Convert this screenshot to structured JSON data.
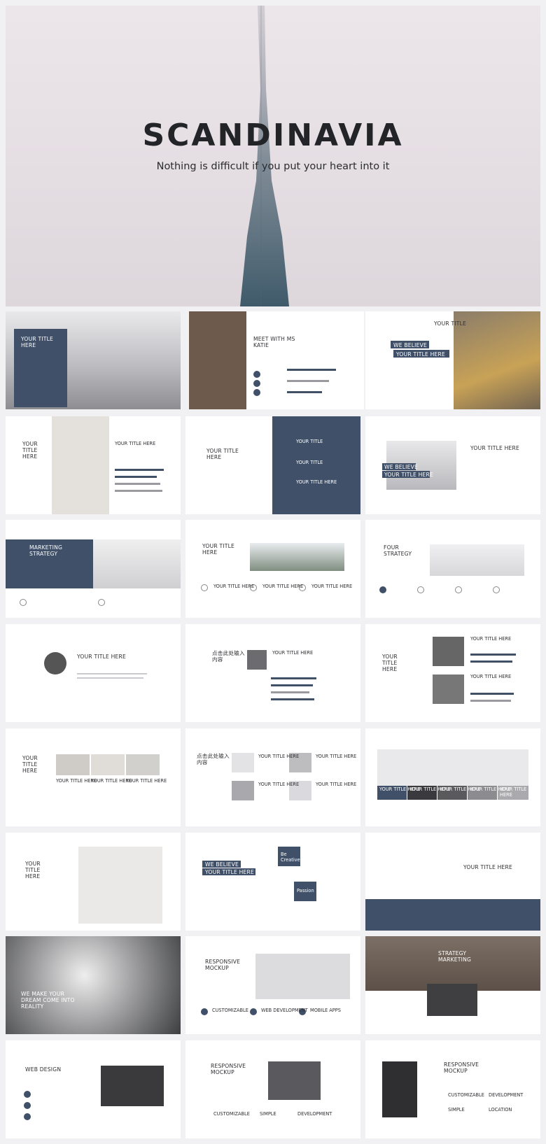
{
  "hero": {
    "title": "SCANDINAVIA",
    "subtitle": "Nothing is difficult if you put your heart into it"
  },
  "slides": {
    "s1": {
      "title": "YOUR TITLE HERE"
    },
    "s2": {
      "title": "MEET WITH MS KATIE"
    },
    "s3": {
      "title": "YOUR TITLE",
      "believe": "WE BELIEVE",
      "title2": "YOUR TITLE HERE"
    },
    "s4": {
      "title": "YOUR TITLE HERE",
      "title2": "YOUR TITLE HERE"
    },
    "s5": {
      "title": "YOUR TITLE HERE",
      "item1": "YOUR TITLE",
      "item2": "YOUR TITLE",
      "item3": "YOUR TITLE HERE"
    },
    "s6": {
      "title": "YOUR TITLE HERE",
      "believe": "WE BELIEVE",
      "title2": "YOUR TITLE HERE"
    },
    "s7": {
      "title": "MARKETING STRATEGY"
    },
    "s8": {
      "title": "YOUR TITLE HERE",
      "c1": "YOUR TITLE HERE",
      "c2": "YOUR TITLE HERE",
      "c3": "YOUR TITLE HERE"
    },
    "s9": {
      "title": "FOUR STRATEGY"
    },
    "s10": {
      "title": "YOUR TITLE HERE"
    },
    "s11": {
      "title": "点击此处输入内容",
      "title2": "YOUR TITLE HERE"
    },
    "s12": {
      "title": "YOUR TITLE HERE",
      "t1": "YOUR TITLE HERE",
      "t2": "YOUR TITLE HERE"
    },
    "s13": {
      "title": "YOUR TITLE HERE",
      "t1": "YOUR TITLE HERE",
      "t2": "YOUR TITLE HERE",
      "t3": "YOUR TITLE HERE"
    },
    "s14": {
      "title": "点击此处输入内容",
      "t1": "YOUR TITLE HERE",
      "t2": "YOUR TITLE HERE",
      "t3": "YOUR TITLE HERE",
      "t4": "YOUR TITLE HERE"
    },
    "s15": {
      "t1": "YOUR TITLE HERE",
      "t2": "YOUR TITLE HERE",
      "t3": "YOUR TITLE HERE",
      "t4": "YOUR TITLE HERE",
      "t5": "YOUR TITLE HERE"
    },
    "s16": {
      "title": "YOUR TITLE HERE"
    },
    "s17": {
      "believe": "WE BELIEVE",
      "title2": "YOUR TITLE HERE",
      "be": "Be Creative",
      "passion": "Passion"
    },
    "s18": {
      "title": "YOUR TITLE HERE"
    },
    "s19": {
      "title": "WE MAKE YOUR DREAM COME INTO REALITY"
    },
    "s20": {
      "title": "RESPONSIVE MOCKUP",
      "i1": "CUSTOMIZABLE",
      "i2": "WEB DEVELOPMENT",
      "i3": "MOBILE APPS"
    },
    "s21": {
      "title": "STRATEGY MARKETING"
    },
    "s22": {
      "title": "WEB DESIGN"
    },
    "s23": {
      "title": "RESPONSIVE MOCKUP",
      "i1": "CUSTOMIZABLE",
      "i2": "SIMPLE",
      "i3": "DEVELOPMENT"
    },
    "s24": {
      "title": "RESPONSIVE MOCKUP",
      "i1": "CUSTOMIZABLE",
      "i2": "DEVELOPMENT",
      "i3": "SIMPLE",
      "i4": "LOCATION"
    }
  }
}
